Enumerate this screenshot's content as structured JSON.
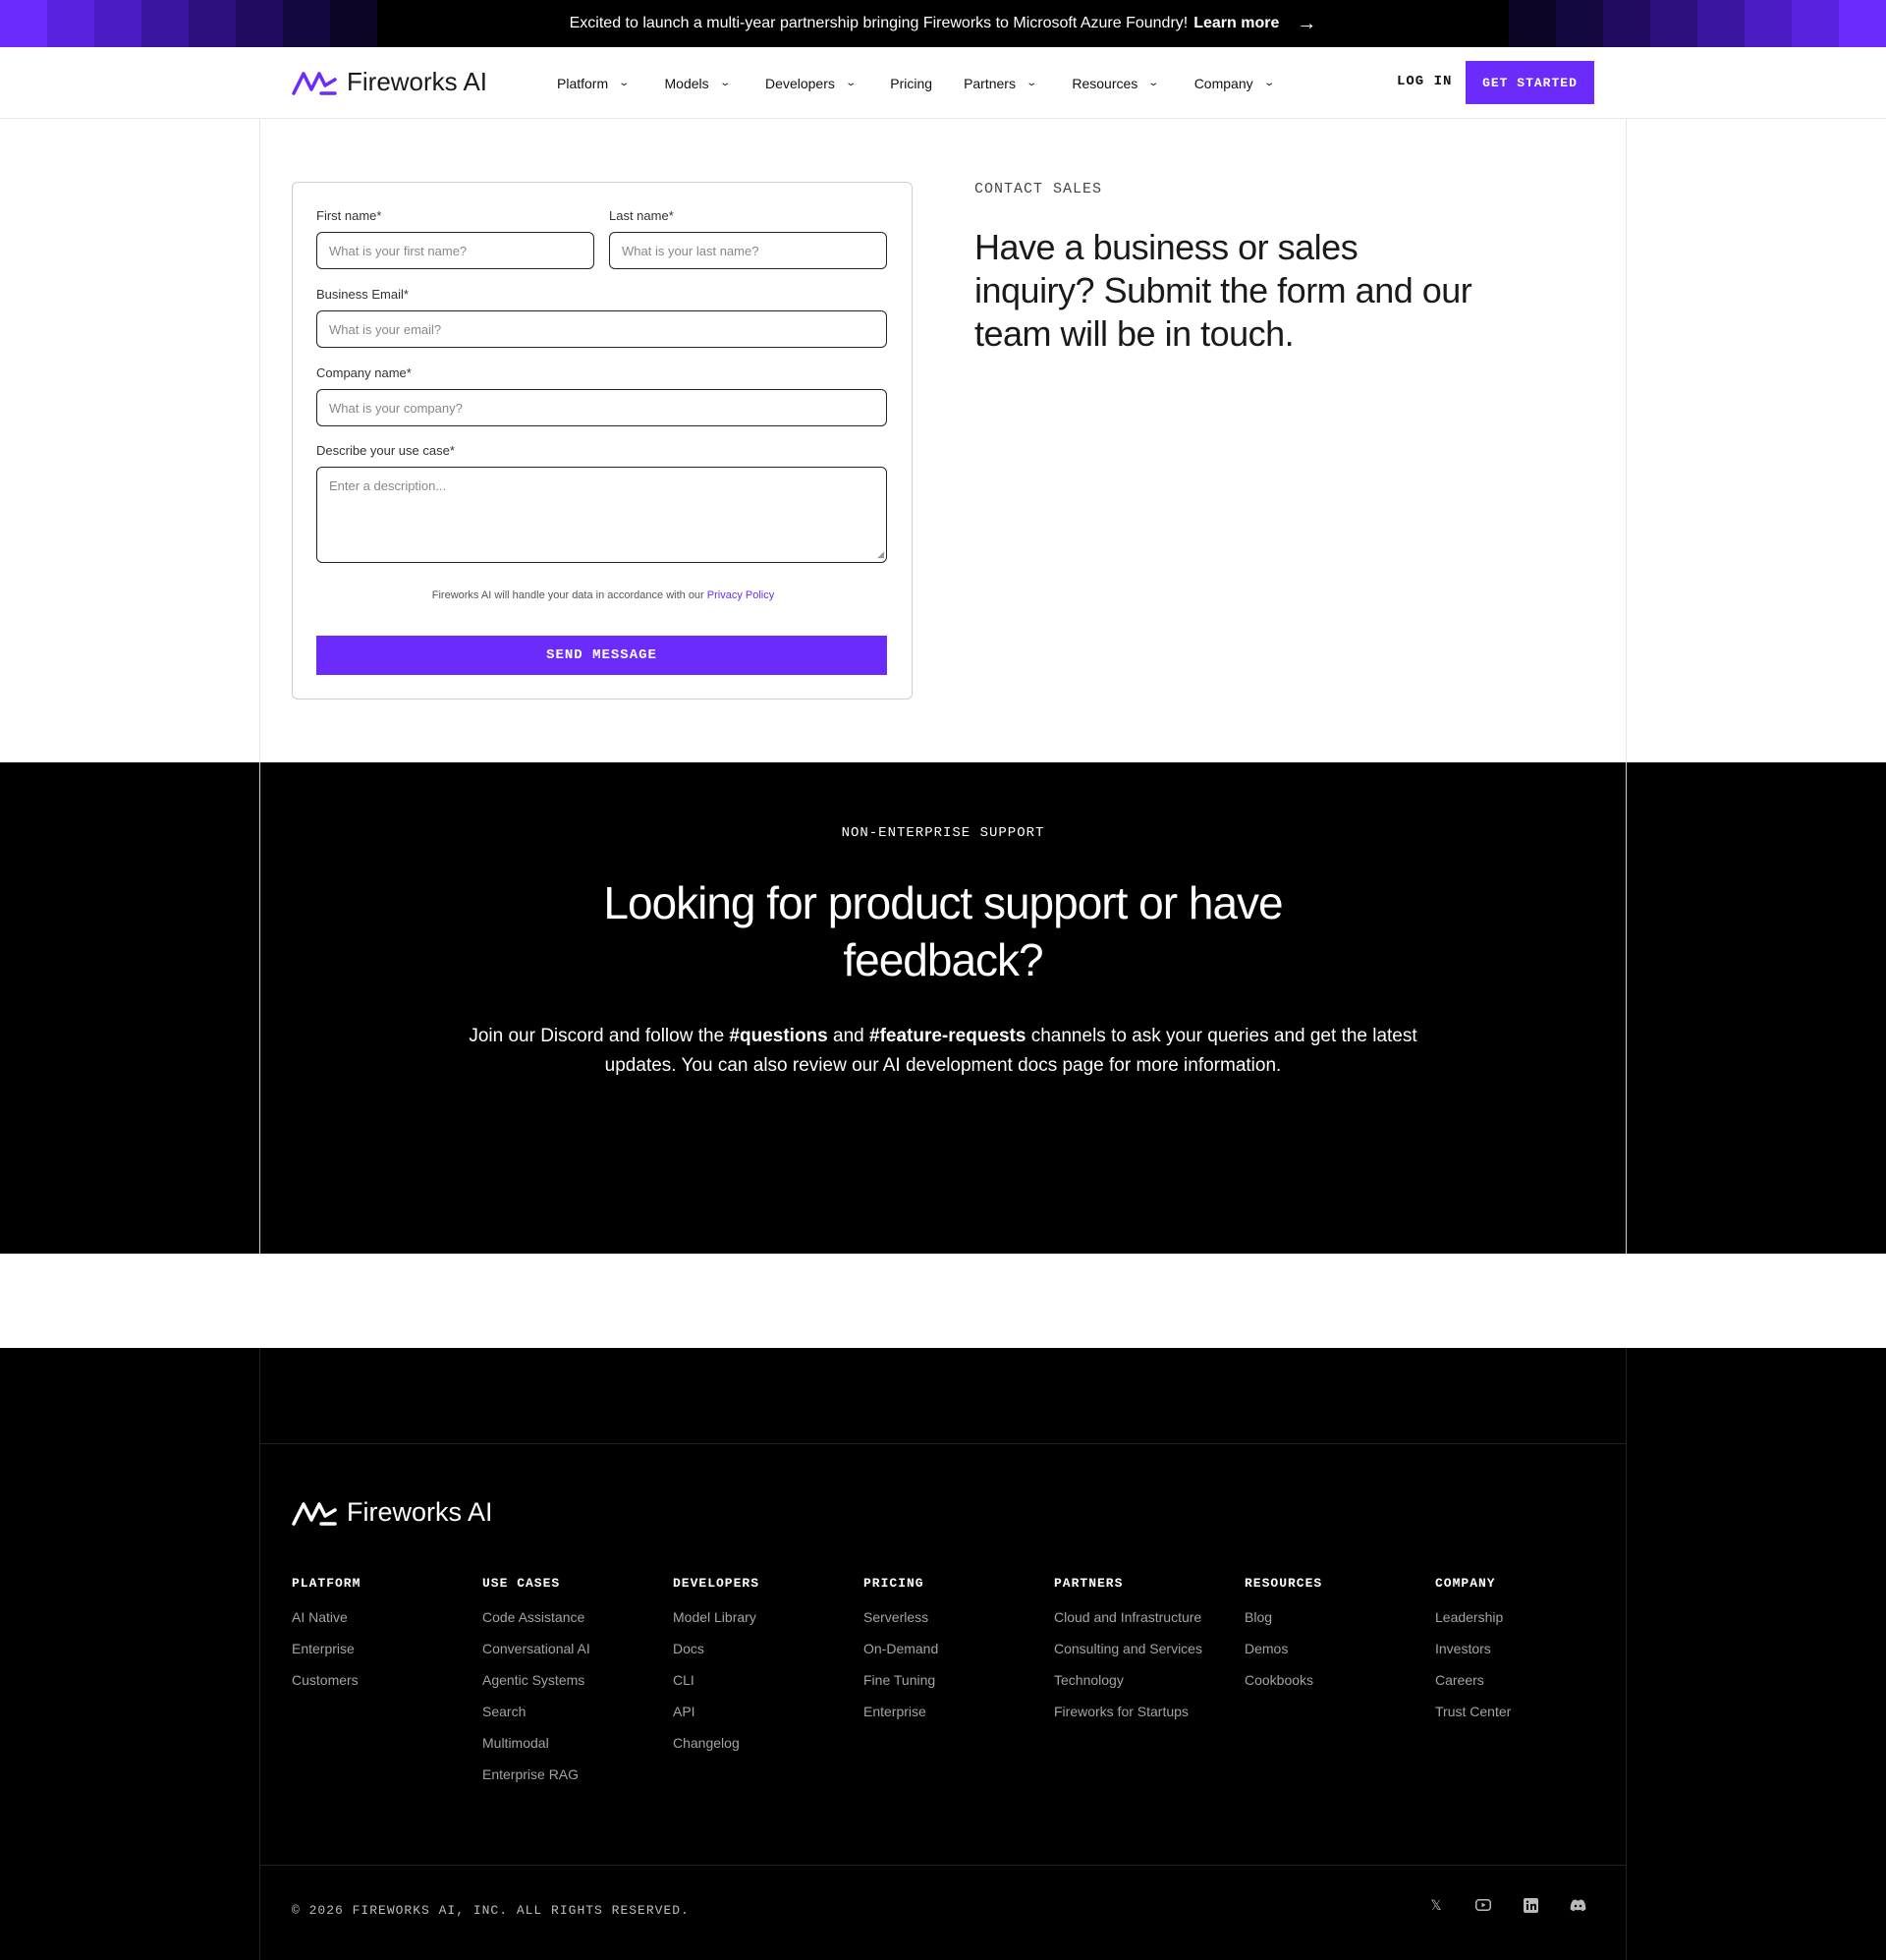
{
  "banner": {
    "text": "Excited to launch a multi-year partnership bringing Fireworks to Microsoft Azure Foundry!",
    "link_label": "Learn more",
    "arrow_icon": "arrow-right-icon"
  },
  "brand": {
    "name": "Fireworks AI",
    "accent": "#6b2cfb"
  },
  "nav": {
    "items": [
      {
        "label": "Platform",
        "dropdown": true
      },
      {
        "label": "Models",
        "dropdown": true
      },
      {
        "label": "Developers",
        "dropdown": true
      },
      {
        "label": "Pricing",
        "dropdown": false
      },
      {
        "label": "Partners",
        "dropdown": true
      },
      {
        "label": "Resources",
        "dropdown": true
      },
      {
        "label": "Company",
        "dropdown": true
      }
    ],
    "login_label": "LOG IN",
    "cta_label": "GET STARTED"
  },
  "form": {
    "first_name": {
      "label": "First name*",
      "placeholder": "What is your first name?"
    },
    "last_name": {
      "label": "Last name*",
      "placeholder": "What is your last name?"
    },
    "email": {
      "label": "Business Email*",
      "placeholder": "What is your email?"
    },
    "company": {
      "label": "Company name*",
      "placeholder": "What is your company?"
    },
    "use_case": {
      "label": "Describe your use case*",
      "placeholder": "Enter a description..."
    },
    "privacy_text": "Fireworks AI will handle your data in accordance with our",
    "privacy_link": "Privacy Policy",
    "submit_label": "SEND MESSAGE"
  },
  "hero": {
    "eyebrow": "CONTACT SALES",
    "title": "Have a business or sales inquiry? Submit the form and our team will be in touch."
  },
  "support": {
    "eyebrow": "NON-ENTERPRISE SUPPORT",
    "title": "Looking for product support or have feedback?",
    "text_1": "Join our Discord and follow the",
    "channel_1": "#questions",
    "text_2": "and",
    "channel_2": "#feature-requests",
    "text_3": "channels to ask your queries and get the latest updates. You can also review our AI development docs page for more information."
  },
  "footer": {
    "columns": [
      {
        "title": "PLATFORM",
        "items": [
          "AI Native",
          "Enterprise",
          "Customers"
        ]
      },
      {
        "title": "USE CASES",
        "items": [
          "Code Assistance",
          "Conversational AI",
          "Agentic Systems",
          "Search",
          "Multimodal",
          "Enterprise RAG"
        ]
      },
      {
        "title": "DEVELOPERS",
        "items": [
          "Model Library",
          "Docs",
          "CLI",
          "API",
          "Changelog"
        ]
      },
      {
        "title": "PRICING",
        "items": [
          "Serverless",
          "On-Demand",
          "Fine Tuning",
          "Enterprise"
        ]
      },
      {
        "title": "PARTNERS",
        "items": [
          "Cloud and Infrastructure",
          "Consulting and Services",
          "Technology",
          "Fireworks for Startups"
        ]
      },
      {
        "title": "RESOURCES",
        "items": [
          "Blog",
          "Demos",
          "Cookbooks"
        ]
      },
      {
        "title": "COMPANY",
        "items": [
          "Leadership",
          "Investors",
          "Careers",
          "Trust Center"
        ]
      }
    ],
    "copyright": "© 2026 FIREWORKS AI, INC. ALL RIGHTS RESERVED.",
    "socials": [
      "x-icon",
      "youtube-icon",
      "linkedin-icon",
      "discord-icon"
    ]
  }
}
